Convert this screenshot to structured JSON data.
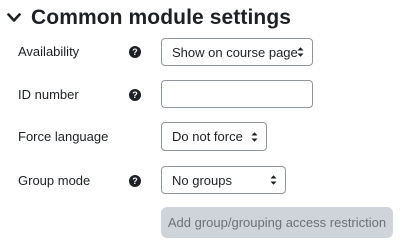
{
  "section": {
    "title": "Common module settings",
    "expand_icon": "chevron-down-icon"
  },
  "fields": {
    "availability": {
      "label": "Availability",
      "value": "Show on course page",
      "help_icon": "question-circle-icon",
      "help_glyph": "?"
    },
    "id_number": {
      "label": "ID number",
      "value": "",
      "help_icon": "question-circle-icon",
      "help_glyph": "?"
    },
    "force_language": {
      "label": "Force language",
      "value": "Do not force"
    },
    "group_mode": {
      "label": "Group mode",
      "value": "No groups",
      "help_icon": "question-circle-icon",
      "help_glyph": "?"
    }
  },
  "restriction_button": {
    "label": "Add group/grouping access restriction",
    "disabled": true
  },
  "colors": {
    "text": "#1d2125",
    "border": "#8f959e",
    "disabled_bg": "#ced4da",
    "disabled_text": "#6a737b"
  }
}
